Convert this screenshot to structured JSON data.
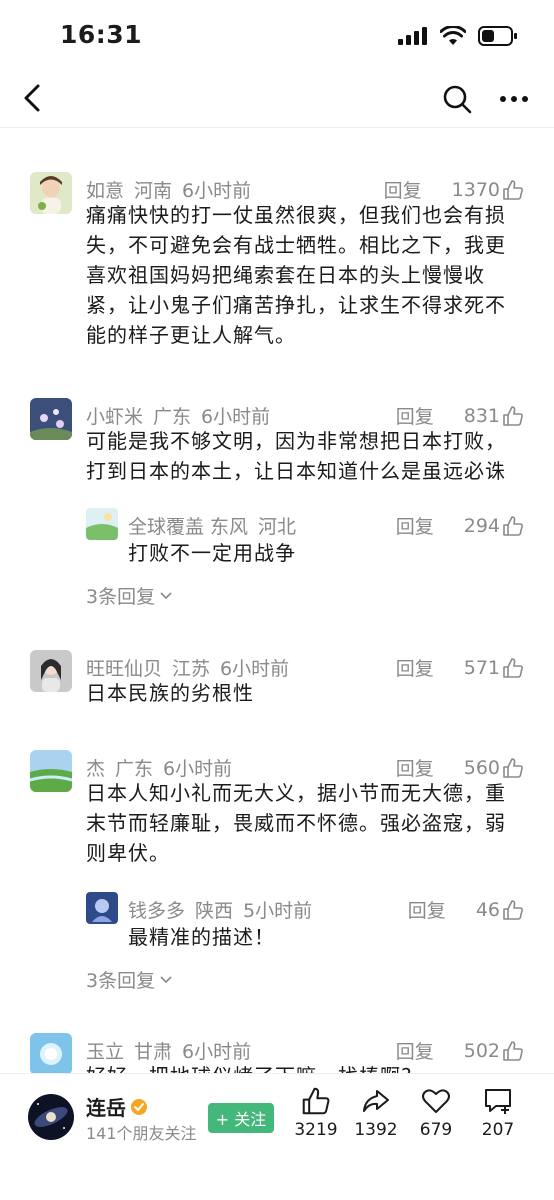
{
  "status_bar": {
    "time": "16:31"
  },
  "comments": [
    {
      "user": "如意",
      "location": "河南",
      "time": "6小时前",
      "reply_label": "回复",
      "likes": "1370",
      "lines": [
        "痛痛快快的打一仗虽然很爽，但我们也会有损",
        "失，不可避免会有战士牺牲。相比之下，我更",
        "喜欢祖国妈妈把绳索套在日本的头上慢慢收",
        "紧，让小鬼子们痛苦挣扎，让求生不得求死不",
        "能的样子更让人解气。"
      ]
    },
    {
      "user": "小虾米",
      "location": "广东",
      "time": "6小时前",
      "reply_label": "回复",
      "likes": "831",
      "lines": [
        "可能是我不够文明，因为非常想把日本打败，",
        "打到日本的本土，让日本知道什么是虽远必诛"
      ],
      "sub_reply": {
        "user": "全球覆盖 东风",
        "location": "河北",
        "reply_label": "回复",
        "likes": "294",
        "text": "打败不一定用战争"
      },
      "more_replies": "3条回复"
    },
    {
      "user": "旺旺仙贝",
      "location": "江苏",
      "time": "6小时前",
      "reply_label": "回复",
      "likes": "571",
      "lines": [
        "日本民族的劣根性"
      ]
    },
    {
      "user": "杰",
      "location": "广东",
      "time": "6小时前",
      "reply_label": "回复",
      "likes": "560",
      "lines": [
        "日本人知小礼而无大义，据小节而无大德，重",
        "末节而轻廉耻，畏威而不怀德。强必盗寇，弱",
        "则卑伏。"
      ],
      "sub_reply": {
        "user": "钱多多",
        "location": "陕西",
        "time": "5小时前",
        "reply_label": "回复",
        "likes": "46",
        "text": "最精准的描述！"
      },
      "more_replies": "3条回复"
    },
    {
      "user": "玉立",
      "location": "甘肃",
      "time": "6小时前",
      "reply_label": "回复",
      "likes": "502",
      "lines": [
        "好好，把地球仪烤了下嘛，找棒啊?"
      ]
    }
  ],
  "bottom_bar": {
    "author_name": "连岳",
    "author_sub": "141个朋友关注",
    "follow_label": "+ 关注",
    "likes": "3219",
    "shares": "1392",
    "favorites": "679",
    "comments": "207"
  }
}
